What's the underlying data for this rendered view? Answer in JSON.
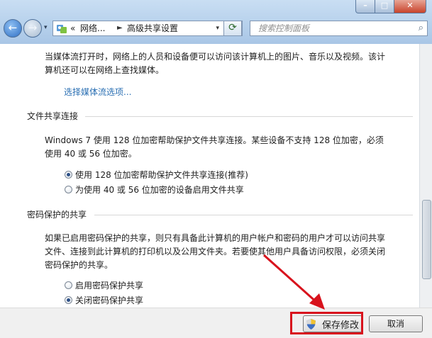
{
  "address_bar": {
    "prefix": "«",
    "crumbs": [
      "网络...",
      "高级共享设置"
    ],
    "separator": "►"
  },
  "search": {
    "placeholder": "搜索控制面板"
  },
  "window_controls": {
    "minimize": "–",
    "maximize": "□",
    "close": "✕"
  },
  "media_section": {
    "text_line1": "当媒体流打开时，网络上的人员和设备便可以访问该计算机上的图片、音乐以及视频。该计",
    "text_line2": "算机还可以在网络上查找媒体。",
    "link": "选择媒体流选项..."
  },
  "file_sharing": {
    "title": "文件共享连接",
    "desc_line1": "Windows 7 使用 128 位加密帮助保护文件共享连接。某些设备不支持 128 位加密，必须",
    "desc_line2": "使用 40 或 56 位加密。",
    "options": [
      {
        "label": "使用 128 位加密帮助保护文件共享连接(推荐)",
        "checked": true
      },
      {
        "label": "为使用 40 或 56 位加密的设备启用文件共享",
        "checked": false
      }
    ]
  },
  "password_sharing": {
    "title": "密码保护的共享",
    "desc_line1": "如果已启用密码保护的共享，则只有具备此计算机的用户帐户和密码的用户才可以访问共享",
    "desc_line2": "文件、连接到此计算机的打印机以及公用文件夹。若要使其他用户具备访问权限，必须关闭",
    "desc_line3": "密码保护的共享。",
    "options": [
      {
        "label": "启用密码保护共享",
        "checked": false
      },
      {
        "label": "关闭密码保护共享",
        "checked": true
      }
    ]
  },
  "footer": {
    "save_label": "保存修改",
    "cancel_label": "取消"
  },
  "colors": {
    "highlight": "#d8131d",
    "link": "#2a6fb3"
  },
  "icons": [
    "back-arrow-icon",
    "forward-arrow-icon",
    "control-panel-icon",
    "refresh-icon",
    "search-icon",
    "uac-shield-icon",
    "radio-button"
  ]
}
